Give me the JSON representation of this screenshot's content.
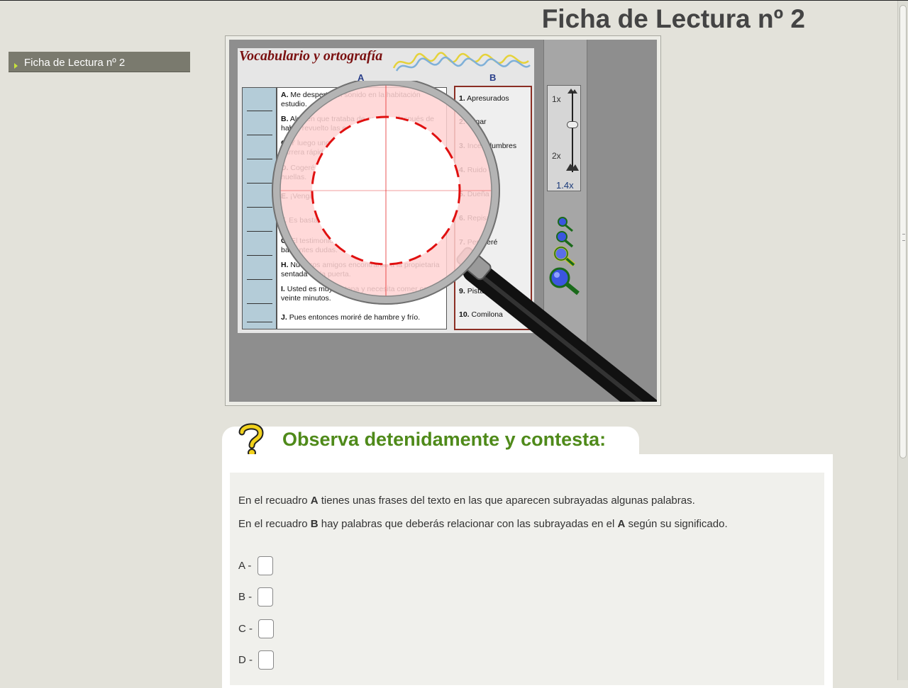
{
  "page": {
    "title": "Ficha de Lectura nº 2"
  },
  "nav": {
    "items": [
      {
        "label": "Ficha de Lectura nº 2"
      }
    ]
  },
  "worksheet": {
    "title": "Vocabulario y ortografía",
    "column_a_label": "A",
    "column_b_label": "B",
    "sentences": [
      {
        "letter": "A.",
        "text": "Me despertó un sonido en la habitación estudio."
      },
      {
        "letter": "B.",
        "text": "Alguien que trataba de escapar después de haber revuelto las estanterías."
      },
      {
        "letter": "C.",
        "text": "Y luego unos pasos acelerados como de carrera rápida y corta."
      },
      {
        "letter": "D.",
        "text": "Cogeré mi lupa y veremos si ha dejado huellas."
      },
      {
        "letter": "E.",
        "text": "¡Venga! Le mostraré el sitio exacto."
      },
      {
        "letter": "F.",
        "text": "Es bastante torpe fuera del agua."
      },
      {
        "letter": "G.",
        "text": "El testimonio de ambos puede aclarar bastantes dudas."
      },
      {
        "letter": "H.",
        "text": "Nuestros amigos encontraron a la propietaria sentada en la puerta."
      },
      {
        "letter": "I.",
        "text": "Usted es muy glotona y necesita comer cada veinte minutos."
      },
      {
        "letter": "J.",
        "text": "Pues entonces moriré de hambre y frío."
      }
    ],
    "words": [
      {
        "num": "1.",
        "text": "Apresurados"
      },
      {
        "num": "2.",
        "text": "Lugar"
      },
      {
        "num": "3.",
        "text": "Incertidumbres"
      },
      {
        "num": "4.",
        "text": "Ruido"
      },
      {
        "num": "5.",
        "text": "Dueña"
      },
      {
        "num": "6.",
        "text": "Repisas"
      },
      {
        "num": "7.",
        "text": "Pereceré"
      },
      {
        "num": "8.",
        "text": ""
      },
      {
        "num": "9.",
        "text": "Pistas"
      },
      {
        "num": "10.",
        "text": "Comilona"
      }
    ]
  },
  "zoom": {
    "min_label": "1x",
    "max_label": "2x",
    "value": "1.4x",
    "level": 0.4
  },
  "question": {
    "title": "Observa detenidamente y contesta:",
    "para1_pre": "En el recuadro ",
    "para1_bold": "A",
    "para1_post": " tienes unas frases del texto en las que aparecen subrayadas algunas palabras.",
    "para2_pre": "En el recuadro ",
    "para2_bold": "B",
    "para2_mid": " hay palabras que deberás relacionar con las subrayadas en el ",
    "para2_bold2": "A",
    "para2_post": " según su significado.",
    "answers": [
      {
        "label": "A -",
        "value": ""
      },
      {
        "label": "B -",
        "value": ""
      },
      {
        "label": "C -",
        "value": ""
      },
      {
        "label": "D -",
        "value": ""
      }
    ]
  },
  "colors": {
    "title_green": "#4f8a1a",
    "nav_bg": "#7a7a6e",
    "nav_arrow": "#c6e23c",
    "lens_red": "#e01010"
  }
}
